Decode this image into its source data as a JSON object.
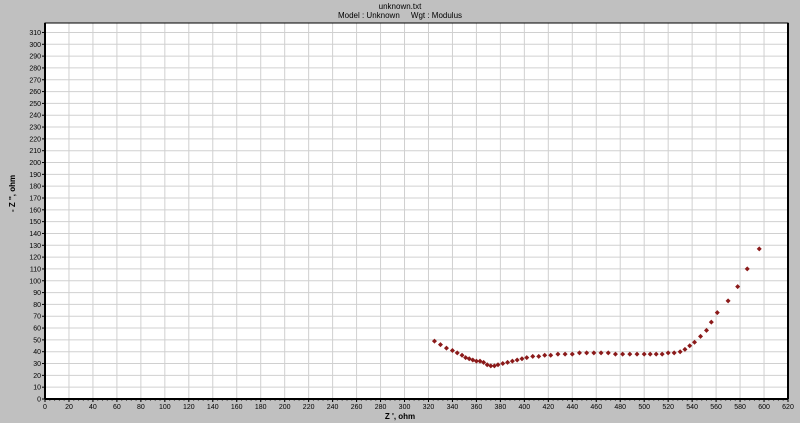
{
  "chart_data": {
    "type": "scatter",
    "title": "unknown.txt",
    "subtitle": "Model : Unknown     Wgt : Modulus",
    "xlabel": "Z ', ohm",
    "ylabel": "- Z '', ohm",
    "xlim": [
      0,
      620
    ],
    "ylim": [
      0,
      318
    ],
    "xticks": [
      0,
      20,
      40,
      60,
      80,
      100,
      120,
      140,
      160,
      180,
      200,
      220,
      240,
      260,
      280,
      300,
      320,
      340,
      360,
      380,
      400,
      420,
      440,
      460,
      480,
      500,
      520,
      540,
      560,
      580,
      600,
      620
    ],
    "yticks": [
      0,
      10,
      20,
      30,
      40,
      50,
      60,
      70,
      80,
      90,
      100,
      110,
      120,
      130,
      140,
      150,
      160,
      170,
      180,
      190,
      200,
      210,
      220,
      230,
      240,
      250,
      260,
      270,
      280,
      290,
      300,
      310
    ],
    "grid": true,
    "marker_color": "#8b1a1a",
    "points": [
      [
        325,
        49
      ],
      [
        330,
        46
      ],
      [
        335,
        43
      ],
      [
        340,
        41
      ],
      [
        344,
        39
      ],
      [
        348,
        37
      ],
      [
        351,
        35
      ],
      [
        354,
        34
      ],
      [
        357,
        33
      ],
      [
        360,
        32
      ],
      [
        363,
        32
      ],
      [
        366,
        31
      ],
      [
        369,
        29
      ],
      [
        372,
        28
      ],
      [
        375,
        28
      ],
      [
        378,
        29
      ],
      [
        382,
        30
      ],
      [
        386,
        31
      ],
      [
        390,
        32
      ],
      [
        394,
        33
      ],
      [
        398,
        34
      ],
      [
        402,
        35
      ],
      [
        407,
        36
      ],
      [
        412,
        36
      ],
      [
        417,
        37
      ],
      [
        422,
        37
      ],
      [
        428,
        38
      ],
      [
        434,
        38
      ],
      [
        440,
        38
      ],
      [
        446,
        39
      ],
      [
        452,
        39
      ],
      [
        458,
        39
      ],
      [
        464,
        39
      ],
      [
        470,
        39
      ],
      [
        476,
        38
      ],
      [
        482,
        38
      ],
      [
        488,
        38
      ],
      [
        494,
        38
      ],
      [
        500,
        38
      ],
      [
        505,
        38
      ],
      [
        510,
        38
      ],
      [
        515,
        38
      ],
      [
        520,
        39
      ],
      [
        525,
        39
      ],
      [
        530,
        40
      ],
      [
        534,
        42
      ],
      [
        538,
        45
      ],
      [
        542,
        48
      ],
      [
        547,
        53
      ],
      [
        552,
        58
      ],
      [
        556,
        65
      ],
      [
        561,
        73
      ],
      [
        570,
        83
      ],
      [
        578,
        95
      ],
      [
        586,
        110
      ],
      [
        596,
        127
      ]
    ]
  }
}
